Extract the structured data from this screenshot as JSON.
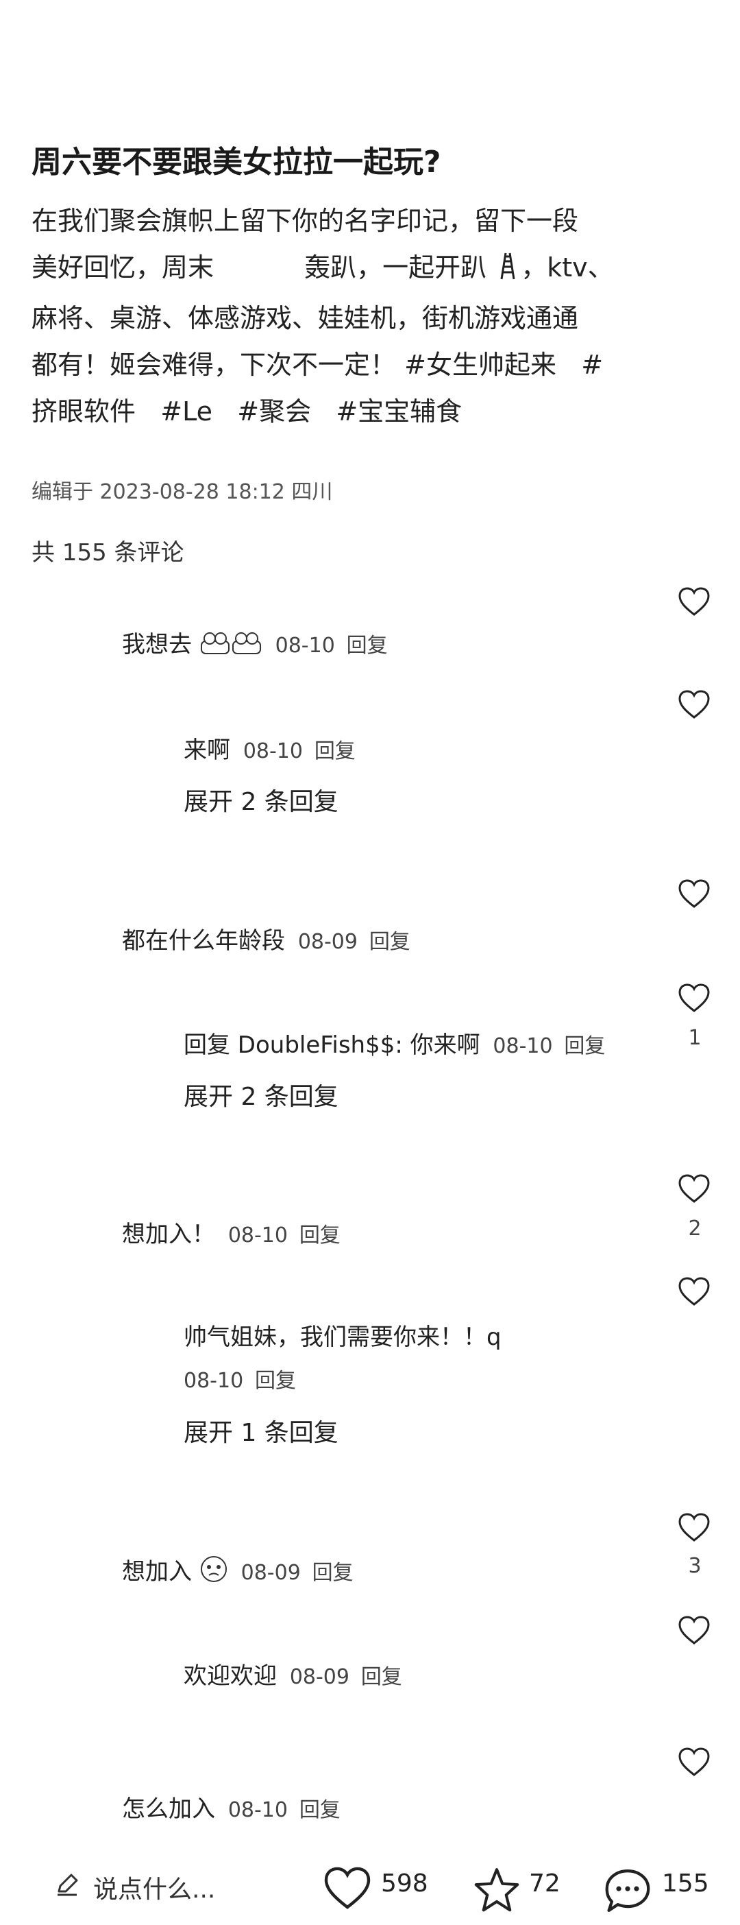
{
  "post": {
    "title": "周六要不要跟美女拉拉一起玩?",
    "lines": [
      "在我们聚会旗帜上留下你的名字印记，留下一段",
      "美好回忆，周末 ",
      "轰趴，一起开趴",
      "，ktv、",
      "麻将、桌游、体感游戏、娃娃机，街机游戏通通",
      "都有！姬会难得，下次不一定！"
    ],
    "tags": [
      "#女生帅起来",
      "#",
      "挤眼软件",
      "#Le",
      "#聚会",
      "#宝宝辅食"
    ],
    "meta": "编辑于 2023-08-28 18:12 四川",
    "comment_count": "共 155 条评论"
  },
  "comments": [
    {
      "text": "我想去",
      "date": "08-10",
      "reply": "回复",
      "likes": ""
    },
    {
      "text": "来啊",
      "date": "08-10",
      "reply": "回复",
      "likes": "",
      "expand": "展开 2 条回复"
    },
    {
      "text": "都在什么年龄段",
      "date": "08-09",
      "reply": "回复",
      "likes": ""
    },
    {
      "text": "回复 DoubleFish$$: 你来啊",
      "date": "08-10",
      "reply": "回复",
      "likes": "1",
      "expand": "展开 2 条回复"
    },
    {
      "text": "想加入！",
      "date": "08-10",
      "reply": "回复",
      "likes": "2"
    },
    {
      "text": "帅气姐妹，我们需要你来！！q",
      "date": "08-10",
      "reply": "回复",
      "likes": "",
      "expand": "展开 1 条回复"
    },
    {
      "text": "想加入",
      "date": "08-09",
      "reply": "回复",
      "likes": "3"
    },
    {
      "text": "欢迎欢迎",
      "date": "08-09",
      "reply": "回复",
      "likes": ""
    },
    {
      "text": "怎么加入",
      "date": "08-10",
      "reply": "回复",
      "likes": ""
    }
  ],
  "bottom_bar": {
    "say_placeholder": "说点什么...",
    "likes": "598",
    "stars": "72",
    "comments": "155"
  }
}
